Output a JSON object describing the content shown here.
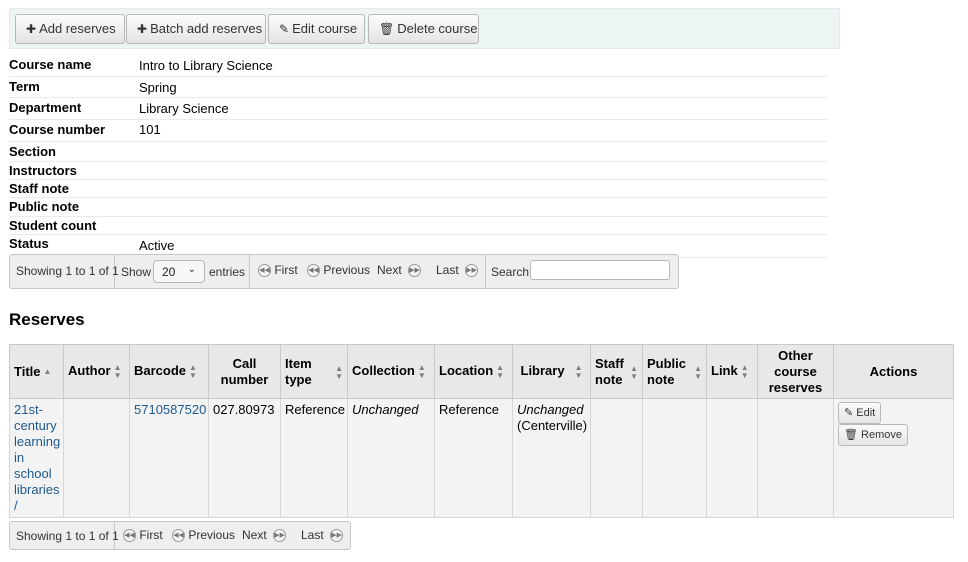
{
  "toolbar": {
    "add_reserves": "Add reserves",
    "batch_add_reserves": "Batch add reserves",
    "edit_course": "Edit course",
    "delete_course": "Delete course"
  },
  "course": {
    "name_label": "Course name",
    "name_value": "Intro to Library Science",
    "term_label": "Term",
    "term_value": "Spring",
    "department_label": "Department",
    "department_value": "Library Science",
    "number_label": "Course number",
    "number_value": "101",
    "section_label": "Section",
    "instructors_label": "Instructors",
    "staff_note_label": "Staff note",
    "public_note_label": "Public note",
    "student_count_label": "Student count",
    "status_label": "Status",
    "status_value": "Active"
  },
  "top_pager": {
    "showing": "Showing 1 to 1 of 1",
    "show_label": "Show",
    "entries_value": "20",
    "entries_label": "entries",
    "first": "First",
    "previous": "Previous",
    "next": "Next",
    "last": "Last",
    "search_label": "Search:",
    "search_value": ""
  },
  "reserves": {
    "heading": "Reserves",
    "columns": {
      "title": "Title",
      "author": "Author",
      "barcode": "Barcode",
      "call_number_1": "Call",
      "call_number_2": "number",
      "item_type_1": "Item",
      "item_type_2": "type",
      "collection": "Collection",
      "location": "Location",
      "library": "Library",
      "staff_note_1": "Staff",
      "staff_note_2": "note",
      "public_note_1": "Public",
      "public_note_2": "note",
      "link": "Link",
      "other_1": "Other",
      "other_2": "course",
      "other_3": "reserves",
      "actions": "Actions"
    },
    "rows": [
      {
        "title": "21st-century learning in school libraries /",
        "author": "",
        "barcode": "5710587520",
        "call_number": "027.80973",
        "item_type": "Reference",
        "collection": "Unchanged",
        "location": "Reference",
        "library_status": "Unchanged",
        "library_name": "(Centerville)",
        "staff_note": "",
        "public_note": "",
        "link": "",
        "other_reserves": "",
        "edit_label": "Edit",
        "remove_label": "Remove"
      }
    ]
  },
  "bottom_pager": {
    "showing": "Showing 1 to 1 of 1",
    "first": "First",
    "previous": "Previous",
    "next": "Next",
    "last": "Last"
  },
  "icons": {
    "add": "plus-icon",
    "edit": "pencil-icon",
    "delete": "trash-icon",
    "first": "first-page-icon",
    "previous": "previous-page-icon",
    "next": "next-page-icon",
    "last": "last-page-icon"
  }
}
